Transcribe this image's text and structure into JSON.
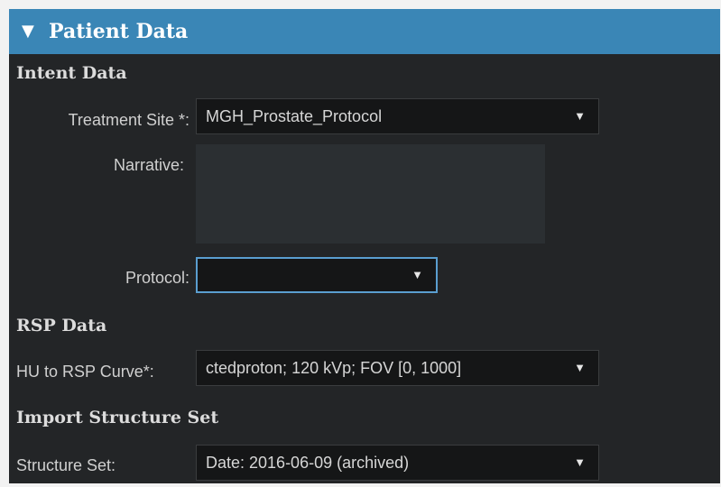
{
  "header": {
    "title": "Patient Data",
    "collapse_icon": "triangle-down-icon"
  },
  "intent": {
    "heading": "Intent Data",
    "treatment_site_label": "Treatment Site *:",
    "treatment_site_value": "MGH_Prostate_Protocol",
    "narrative_label": "Narrative:",
    "narrative_value": "",
    "protocol_label": "Protocol:",
    "protocol_value": ""
  },
  "rsp": {
    "heading": "RSP Data",
    "curve_label": "HU to RSP Curve*:",
    "curve_value": "ctedproton; 120 kVp; FOV [0, 1000]"
  },
  "structure": {
    "heading": "Import Structure Set",
    "set_label": "Structure Set:",
    "set_value": "Date: 2016-06-09 (archived)"
  },
  "icons": {
    "dropdown": "chevron-down-icon"
  },
  "colors": {
    "header_bg": "#3a86b6",
    "panel_bg": "#232527",
    "focus_border": "#5a9ed0"
  }
}
